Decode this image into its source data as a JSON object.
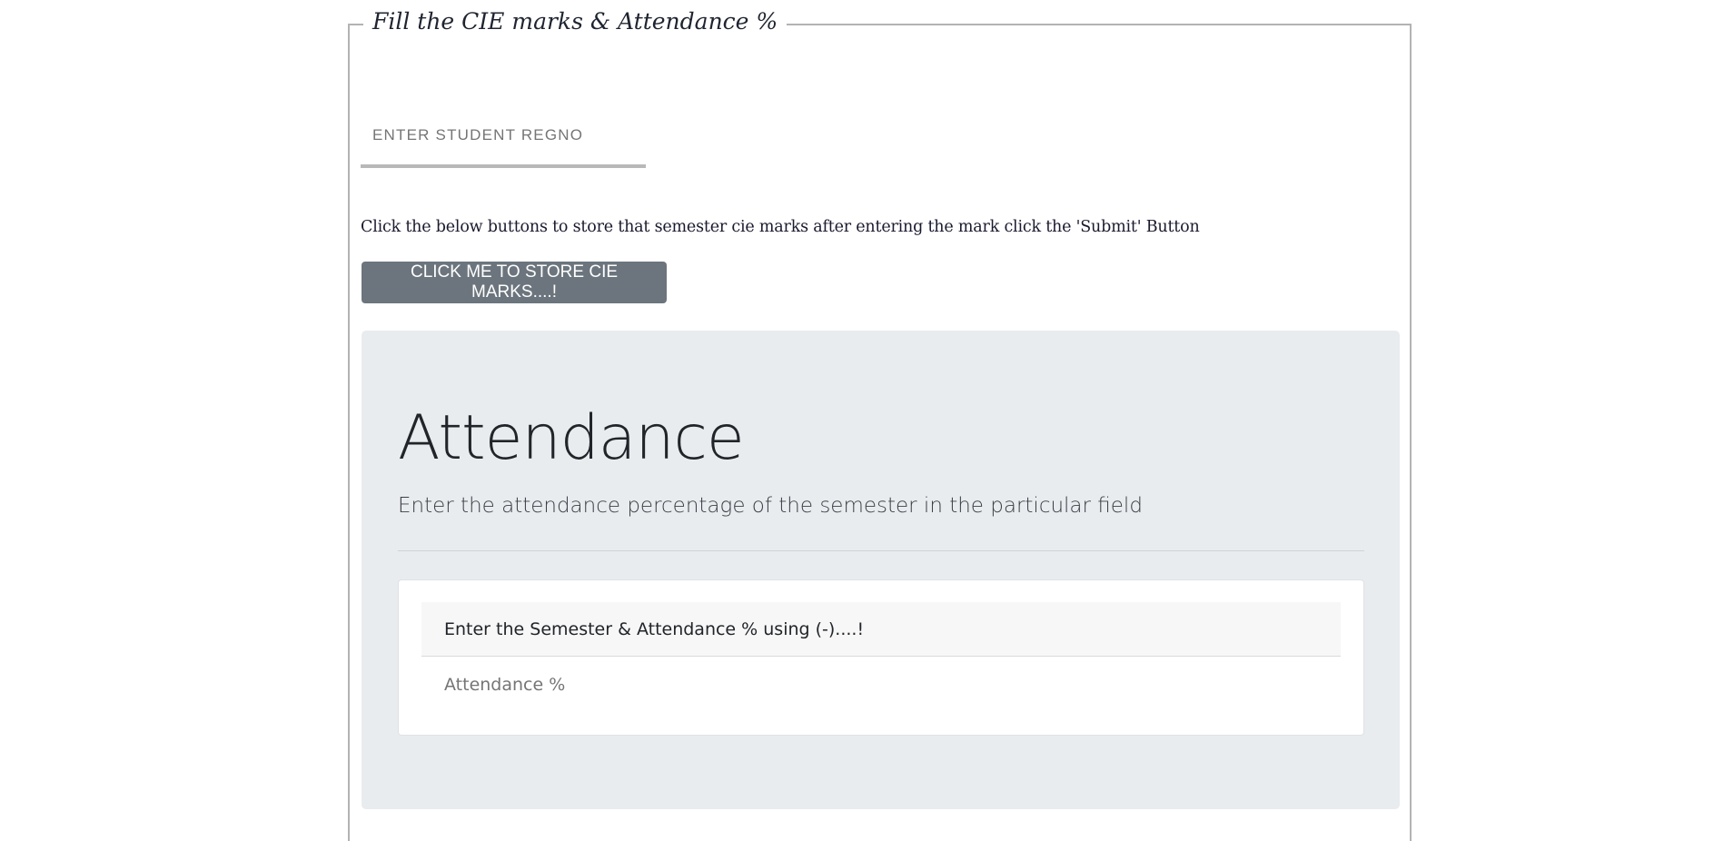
{
  "form": {
    "legend": "Fill the CIE marks & Attendance %",
    "regno_placeholder": "ENTER STUDENT REGNO",
    "instruction": "Click the below buttons to store that semester cie marks after entering the mark click the 'Submit' Button",
    "cie_button_label": "CLICK ME TO STORE CIE MARKS....!"
  },
  "attendance": {
    "title": "Attendance",
    "lead": "Enter the attendance percentage of the semester in the particular field",
    "card_header": "Enter the Semester & Attendance % using (-)....!",
    "input_placeholder": "Attendance %"
  },
  "colors": {
    "button_bg": "#6c757d",
    "jumbotron_bg": "#e9ecef",
    "fieldset_border": "#b3b3b3"
  }
}
